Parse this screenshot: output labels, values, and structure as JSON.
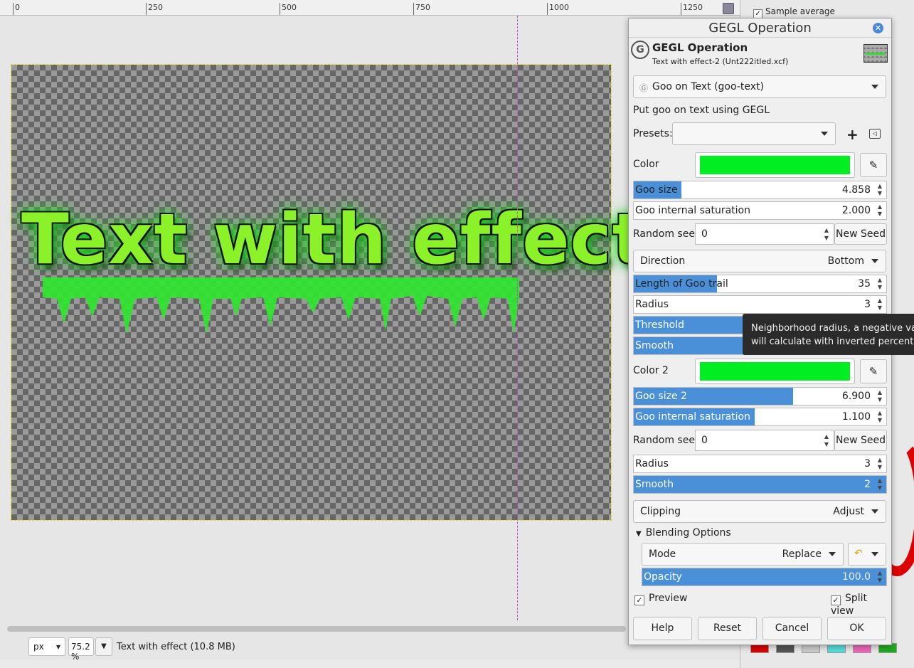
{
  "ruler": {
    "ticks": [
      "0",
      "250",
      "500",
      "750",
      "1000",
      "1250"
    ]
  },
  "canvas": {
    "text_on_image": "Text with effect"
  },
  "statusbar": {
    "unit": "px",
    "zoom": "75.2 %",
    "status": "Text with effect (10.8 MB)"
  },
  "right_panel": {
    "sample_average": "Sample average"
  },
  "dialog": {
    "title": "GEGL Operation",
    "header_title": "GEGL Operation",
    "header_subtitle": "Text with effect-2 (Unt222itled.xcf)",
    "operation": "Goo on Text (goo-text)",
    "description": "Put goo on text using GEGL",
    "presets_label": "Presets:",
    "presets_value": "",
    "color_label": "Color",
    "color_value": "#00ee22",
    "goo_size": {
      "label": "Goo size",
      "value": "4.858",
      "fill": 0.19
    },
    "goo_internal_saturation": {
      "label": "Goo internal saturation",
      "value": "2.000",
      "fill": 0.0
    },
    "random_seed_label": "Random seed",
    "random_seed_value": "0",
    "new_seed": "New Seed",
    "direction": {
      "label": "Direction",
      "value": "Bottom"
    },
    "length_goo_trail": {
      "label": "Length of Goo trail",
      "value": "35",
      "fill": 0.33
    },
    "radius": {
      "label": "Radius",
      "value": "3",
      "fill": 0.0
    },
    "threshold": {
      "label": "Threshold",
      "value": "",
      "fill": 1.0
    },
    "smooth": {
      "label": "Smooth",
      "value": "",
      "fill": 1.0
    },
    "color2_label": "Color 2",
    "color2_value": "#00ee22",
    "goo_size_2": {
      "label": "Goo size 2",
      "value": "6.900",
      "fill": 0.63
    },
    "goo_internal_saturation_2": {
      "label": "Goo internal saturation",
      "value": "1.100",
      "fill": 0.48
    },
    "random_seed2_label": "Random seed",
    "random_seed2_value": "0",
    "new_seed2": "New Seed",
    "radius2": {
      "label": "Radius",
      "value": "3",
      "fill": 0.0
    },
    "smooth2": {
      "label": "Smooth",
      "value": "2",
      "fill": 1.0
    },
    "clipping": {
      "label": "Clipping",
      "value": "Adjust"
    },
    "blending_options": "Blending Options",
    "mode": {
      "label": "Mode",
      "value": "Replace"
    },
    "opacity": {
      "label": "Opacity",
      "value": "100.0",
      "fill": 1.0
    },
    "preview": "Preview",
    "split_view": "Split view",
    "help": "Help",
    "reset": "Reset",
    "cancel": "Cancel",
    "ok": "OK"
  },
  "tooltip": {
    "line1": "Neighborhood radius, a negative valu",
    "line2": "will calculate with inverted percentiles"
  }
}
